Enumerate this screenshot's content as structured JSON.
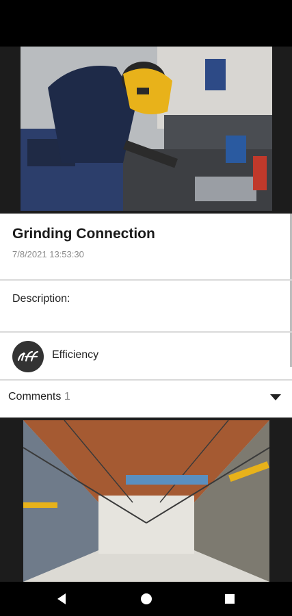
{
  "post": {
    "title": "Grinding Connection",
    "date": "7/8/2021 13:53:30",
    "description_label": "Description:",
    "tag_label": "Efficiency",
    "comments_label": "Comments",
    "comments_count": "1"
  },
  "icons": {
    "tag_logo": "rf-logo-icon",
    "expand": "chevron-down-icon",
    "nav_back": "back-triangle-icon",
    "nav_home": "home-circle-icon",
    "nav_recents": "recents-square-icon"
  },
  "colors": {
    "card_bg": "#ffffff",
    "divider": "#d9d9d9",
    "text_primary": "#1a1a1a",
    "text_secondary": "#8a8a8a",
    "logo_bg": "#333333"
  }
}
